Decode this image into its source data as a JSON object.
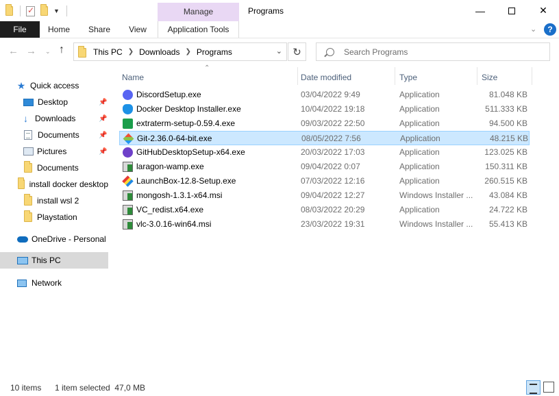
{
  "window": {
    "title": "Programs",
    "manage_label": "Manage"
  },
  "ribbon": {
    "tabs": [
      "File",
      "Home",
      "Share",
      "View",
      "Application Tools"
    ]
  },
  "address": {
    "breadcrumb": [
      "This PC",
      "Downloads",
      "Programs"
    ]
  },
  "search": {
    "placeholder": "Search Programs"
  },
  "navpane": {
    "items": [
      {
        "label": "Quick access",
        "icon": "star-icon"
      },
      {
        "label": "Desktop",
        "icon": "desktop-icon",
        "pinned": true
      },
      {
        "label": "Downloads",
        "icon": "downloads-icon",
        "pinned": true
      },
      {
        "label": "Documents",
        "icon": "documents-icon",
        "pinned": true
      },
      {
        "label": "Pictures",
        "icon": "pictures-icon",
        "pinned": true
      },
      {
        "label": "Documents",
        "icon": "folder-icon"
      },
      {
        "label": "install docker desktop",
        "icon": "folder-icon"
      },
      {
        "label": "install wsl 2",
        "icon": "folder-icon"
      },
      {
        "label": "Playstation",
        "icon": "folder-icon"
      },
      {
        "label": "OneDrive - Personal",
        "icon": "cloud-icon"
      },
      {
        "label": "This PC",
        "icon": "this-pc-icon",
        "selected": true
      },
      {
        "label": "Network",
        "icon": "network-icon"
      }
    ]
  },
  "filelist": {
    "columns": [
      "Name",
      "Date modified",
      "Type",
      "Size"
    ],
    "rows": [
      {
        "name": "DiscordSetup.exe",
        "date": "03/04/2022 9:49",
        "type": "Application",
        "size": "81.048 KB",
        "icon": "discord-icon"
      },
      {
        "name": "Docker Desktop Installer.exe",
        "date": "10/04/2022 19:18",
        "type": "Application",
        "size": "511.333 KB",
        "icon": "docker-icon"
      },
      {
        "name": "extraterm-setup-0.59.4.exe",
        "date": "09/03/2022 22:50",
        "type": "Application",
        "size": "94.500 KB",
        "icon": "extraterm-icon"
      },
      {
        "name": "Git-2.36.0-64-bit.exe",
        "date": "08/05/2022 7:56",
        "type": "Application",
        "size": "48.215 KB",
        "icon": "git-icon",
        "selected": true
      },
      {
        "name": "GitHubDesktopSetup-x64.exe",
        "date": "20/03/2022 17:03",
        "type": "Application",
        "size": "123.025 KB",
        "icon": "github-icon"
      },
      {
        "name": "laragon-wamp.exe",
        "date": "09/04/2022 0:07",
        "type": "Application",
        "size": "150.311 KB",
        "icon": "installer-icon"
      },
      {
        "name": "LaunchBox-12.8-Setup.exe",
        "date": "07/03/2022 12:16",
        "type": "Application",
        "size": "260.515 KB",
        "icon": "launchbox-icon"
      },
      {
        "name": "mongosh-1.3.1-x64.msi",
        "date": "09/04/2022 12:27",
        "type": "Windows Installer ...",
        "size": "43.084 KB",
        "icon": "installer-icon"
      },
      {
        "name": "VC_redist.x64.exe",
        "date": "08/03/2022 20:29",
        "type": "Application",
        "size": "24.722 KB",
        "icon": "installer-icon"
      },
      {
        "name": "vlc-3.0.16-win64.msi",
        "date": "23/03/2022 19:31",
        "type": "Windows Installer ...",
        "size": "55.413 KB",
        "icon": "installer-icon"
      }
    ]
  },
  "status": {
    "item_count": "10 items",
    "selection": "1 item selected  47,0 MB"
  }
}
